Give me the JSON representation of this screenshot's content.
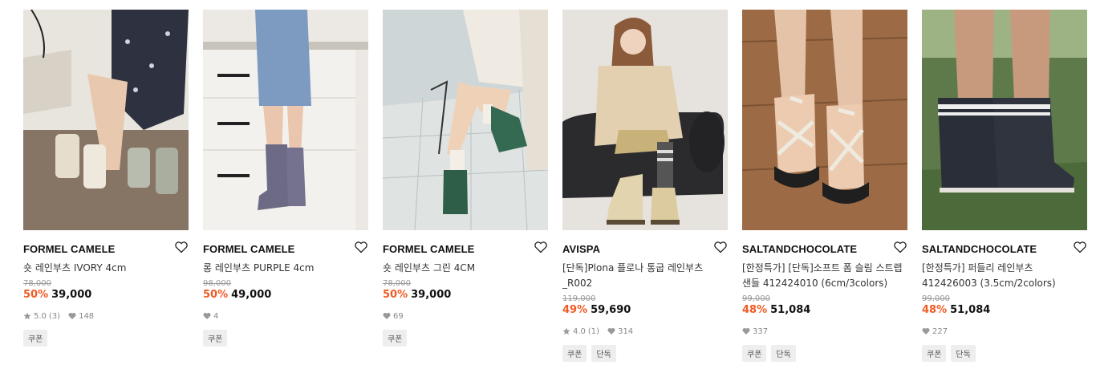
{
  "products": [
    {
      "brand": "FORMEL CAMELE",
      "name": "숏 레인부츠 IVORY 4cm",
      "original_price": "78,000",
      "discount": "50%",
      "price": "39,000",
      "rating": "5.0",
      "reviews": "(3)",
      "likes": "148",
      "tags": [
        "쿠폰"
      ]
    },
    {
      "brand": "FORMEL CAMELE",
      "name": "롱 레인부츠 PURPLE 4cm",
      "original_price": "98,000",
      "discount": "50%",
      "price": "49,000",
      "likes": "4",
      "tags": [
        "쿠폰"
      ]
    },
    {
      "brand": "FORMEL CAMELE",
      "name": "숏 레인부츠 그린 4CM",
      "original_price": "78,000",
      "discount": "50%",
      "price": "39,000",
      "likes": "69",
      "tags": [
        "쿠폰"
      ]
    },
    {
      "brand": "AVISPA",
      "name_line1": "[단독]Plona 플로나 통굽 레인부츠",
      "name_line2": "_R002",
      "original_price": "119,000",
      "discount": "49%",
      "price": "59,690",
      "rating": "4.0",
      "reviews": "(1)",
      "likes": "314",
      "tags": [
        "쿠폰",
        "단독"
      ]
    },
    {
      "brand": "SALTANDCHOCOLATE",
      "name_line1": "[한정특가] [단독]소프트 폼 슬림 스트랩",
      "name_line2": "샌들 412424010 (6cm/3colors)",
      "original_price": "99,000",
      "discount": "48%",
      "price": "51,084",
      "likes": "337",
      "tags": [
        "쿠폰",
        "단독"
      ]
    },
    {
      "brand": "SALTANDCHOCOLATE",
      "name_line1": "[한정특가] 퍼들리 레인부츠",
      "name_line2": "412426003 (3.5cm/2colors)",
      "original_price": "99,000",
      "discount": "48%",
      "price": "51,084",
      "likes": "227",
      "tags": [
        "쿠폰",
        "단독"
      ]
    }
  ],
  "colors": {
    "discount": "#f15a24",
    "tag_bg": "#eeeeee"
  },
  "icons": {
    "wishlist": "heart-outline-icon",
    "rating": "star-icon",
    "likes": "heart-filled-icon"
  }
}
